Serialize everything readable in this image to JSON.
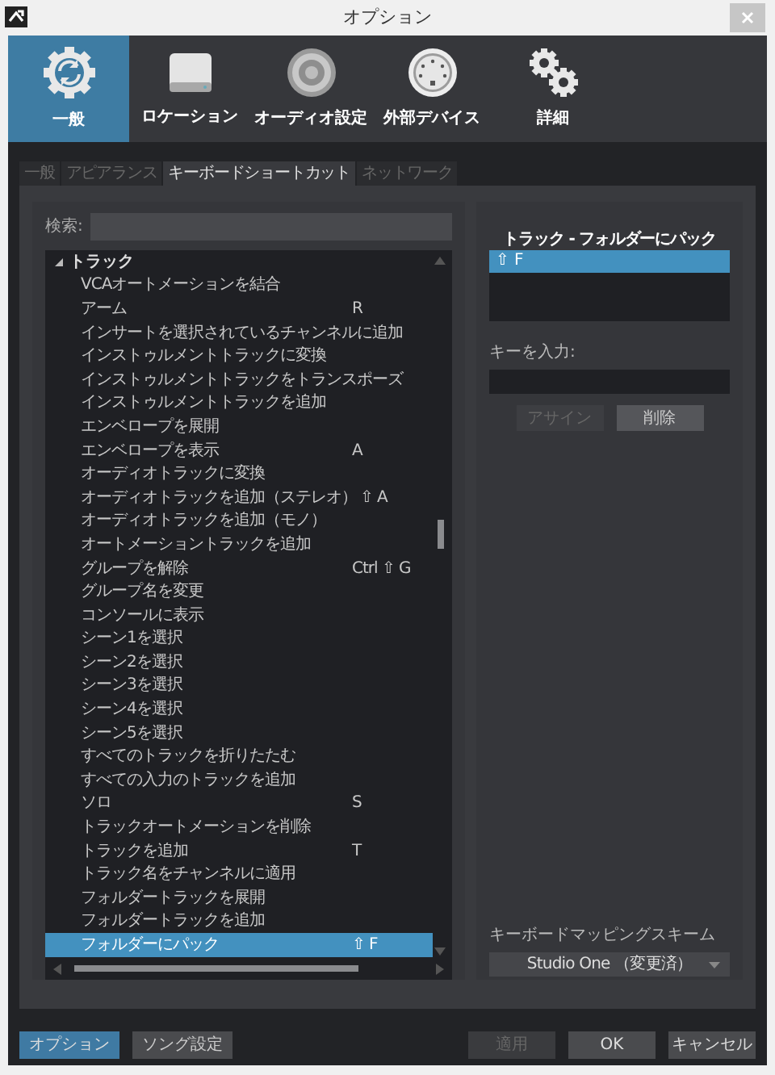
{
  "window": {
    "title": "オプション"
  },
  "categories": [
    {
      "label": "一般",
      "kind": "general",
      "selected": true
    },
    {
      "label": "ロケーション",
      "kind": "drive",
      "selected": false
    },
    {
      "label": "オーディオ設定",
      "kind": "speaker",
      "selected": false
    },
    {
      "label": "外部デバイス",
      "kind": "midi",
      "selected": false
    },
    {
      "label": "詳細",
      "kind": "gears",
      "selected": false
    }
  ],
  "tabs": [
    {
      "label": "一般",
      "selected": false
    },
    {
      "label": "アピアランス",
      "selected": false
    },
    {
      "label": "キーボードショートカット",
      "selected": true
    },
    {
      "label": "ネットワーク",
      "selected": false
    }
  ],
  "search": {
    "label": "検索:"
  },
  "shortcuts": [
    {
      "label": "トラック",
      "expanded": true,
      "children": [
        {
          "label": "VCAオートメーションを結合",
          "selected": false
        },
        {
          "label": "アーム",
          "key": "R",
          "selected": false
        },
        {
          "label": "インサートを選択されているチャンネルに追加",
          "selected": false
        },
        {
          "label": "インストゥルメントトラックに変換",
          "selected": false
        },
        {
          "label": "インストゥルメントトラックをトランスポーズ",
          "selected": false
        },
        {
          "label": "インストゥルメントトラックを追加",
          "selected": false
        },
        {
          "label": "エンベロープを展開",
          "selected": false
        },
        {
          "label": "エンベロープを表示",
          "key": "A",
          "selected": false
        },
        {
          "label": "オーディオトラックに変換",
          "selected": false
        },
        {
          "label": "オーディオトラックを追加（ステレオ）",
          "key": "⇧ A",
          "selected": false
        },
        {
          "label": "オーディオトラックを追加（モノ）",
          "selected": false
        },
        {
          "label": "オートメーショントラックを追加",
          "selected": false
        },
        {
          "label": "グループを解除",
          "key": "Ctrl ⇧ G",
          "selected": false
        },
        {
          "label": "グループ名を変更",
          "selected": false
        },
        {
          "label": "コンソールに表示",
          "selected": false
        },
        {
          "label": "シーン1を選択",
          "selected": false
        },
        {
          "label": "シーン2を選択",
          "selected": false
        },
        {
          "label": "シーン3を選択",
          "selected": false
        },
        {
          "label": "シーン4を選択",
          "selected": false
        },
        {
          "label": "シーン5を選択",
          "selected": false
        },
        {
          "label": "すべてのトラックを折りたたむ",
          "selected": false
        },
        {
          "label": "すべての入力のトラックを追加",
          "selected": false
        },
        {
          "label": "ソロ",
          "key": "S",
          "selected": false
        },
        {
          "label": "トラックオートメーションを削除",
          "selected": false
        },
        {
          "label": "トラックを追加",
          "key": "T",
          "selected": false
        },
        {
          "label": "トラック名をチャンネルに適用",
          "selected": false
        },
        {
          "label": "フォルダートラックを展開",
          "selected": false
        },
        {
          "label": "フォルダートラックを追加",
          "selected": false
        },
        {
          "label": "フォルダーにパック",
          "key": "⇧ F",
          "selected": true
        }
      ]
    }
  ],
  "editor": {
    "title": "トラック - フォルダーにパック",
    "keys": [
      {
        "label": "⇧ F",
        "selected": true
      }
    ],
    "key_input_label": "キーを入力:",
    "buttons": [
      {
        "label": "アサイン",
        "disabled": true
      },
      {
        "label": "削除",
        "disabled": false
      }
    ],
    "scheme_label": "キーボードマッピングスキーム",
    "scheme": "Studio One （変更済）"
  },
  "footer": {
    "left": [
      {
        "label": "オプション",
        "selected": true
      },
      {
        "label": "ソング設定",
        "selected": false
      }
    ],
    "right": [
      {
        "label": "適用",
        "disabled": true
      },
      {
        "label": "OK",
        "disabled": false
      },
      {
        "label": "キャンセル",
        "disabled": false
      }
    ]
  }
}
